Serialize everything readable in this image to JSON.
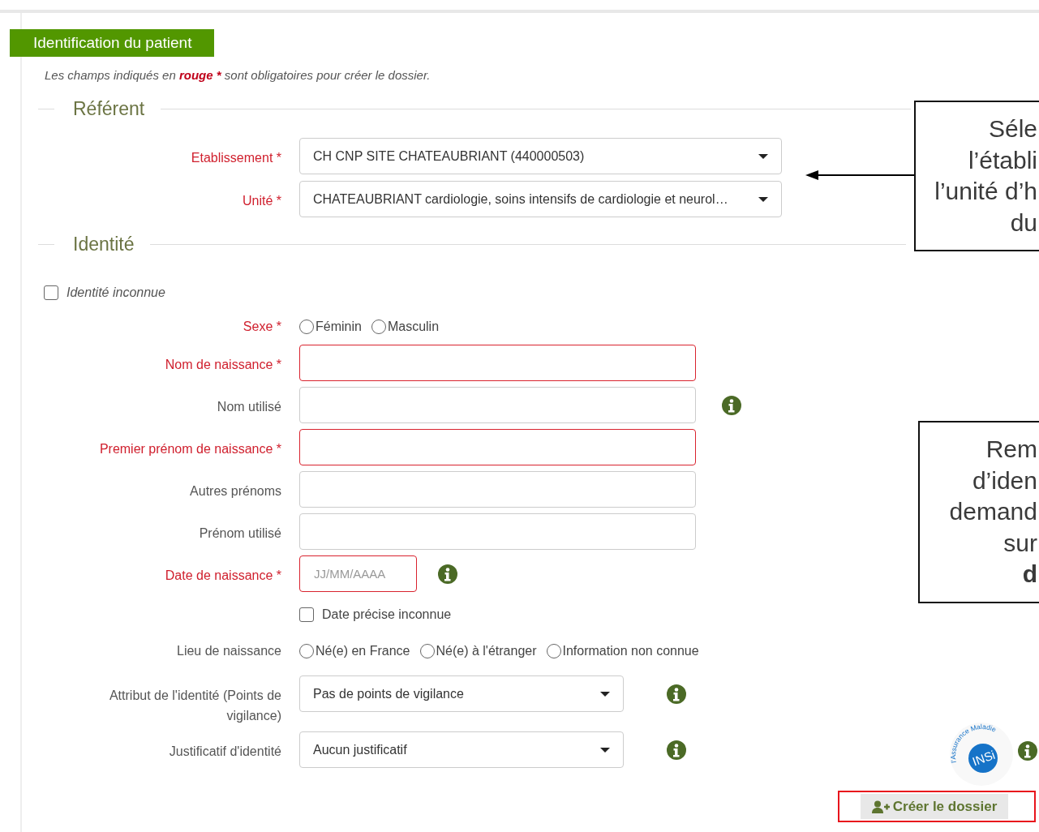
{
  "header": {
    "title": "Identification du patient"
  },
  "notice": {
    "before": "Les champs indiqués en",
    "emphasis": "rouge *",
    "after": "sont obligatoires pour créer le dossier."
  },
  "sections": [
    {
      "legend": "Référent",
      "fields": [
        {
          "kind": "select",
          "label": "Etablissement *",
          "required": true,
          "value": "CH CNP SITE CHATEAUBRIANT (440000503)",
          "info": false
        },
        {
          "kind": "select",
          "label": "Unité *",
          "required": true,
          "value": "CHATEAUBRIANT cardiologie, soins intensifs de cardiologie et neurol…",
          "info": false
        }
      ]
    },
    {
      "legend": "Identité",
      "fields": [
        {
          "kind": "flag",
          "label": "Identité inconnue",
          "checked": false
        },
        {
          "kind": "radio",
          "label": "Sexe *",
          "required": true,
          "options": [
            {
              "label": "Féminin",
              "selected": false
            },
            {
              "label": "Masculin",
              "selected": false
            }
          ]
        },
        {
          "kind": "text",
          "label": "Nom de naissance *",
          "required": true,
          "info": false
        },
        {
          "kind": "text",
          "label": "Nom utilisé",
          "required": false,
          "info": true
        },
        {
          "kind": "text",
          "label": "Premier prénom de naissance *",
          "required": true,
          "info": false
        },
        {
          "kind": "text",
          "label": "Autres prénoms",
          "required": false,
          "info": false
        },
        {
          "kind": "text",
          "label": "Prénom utilisé",
          "required": false,
          "info": false
        },
        {
          "kind": "date",
          "label": "Date de naissance *",
          "required": true,
          "placeholder": "JJ/MM/AAAA",
          "info": true
        },
        {
          "kind": "checkbox",
          "label": "Date précise inconnue",
          "checked": false
        },
        {
          "kind": "radio",
          "label": "Lieu de naissance",
          "required": false,
          "options": [
            {
              "label": "Né(e) en France",
              "selected": false
            },
            {
              "label": "Né(e) à l'étranger",
              "selected": false
            },
            {
              "label": "Information non connue",
              "selected": false
            }
          ]
        },
        {
          "kind": "select",
          "label": "Attribut de l'identité (Points de vigilance)",
          "required": false,
          "value": "Pas de points de vigilance",
          "info": true
        },
        {
          "kind": "select",
          "label": "Justificatif d'identité",
          "required": false,
          "value": "Aucun justificatif",
          "info": true
        }
      ]
    }
  ],
  "insi_logo": {
    "text": "INSi",
    "caption": "l'Assurance Maladie"
  },
  "create_button": {
    "label": "Créer le dossier"
  },
  "callouts": [
    {
      "lines": [
        {
          "text": "Séle",
          "bold": false
        },
        {
          "text": "l’établi",
          "bold": false
        },
        {
          "text": "l’unité d’h",
          "bold": false
        },
        {
          "text": "du",
          "bold": false
        }
      ]
    },
    {
      "lines": [
        {
          "text": "Rem",
          "bold": false
        },
        {
          "text": "d’iden",
          "bold": false
        },
        {
          "text": "demand",
          "bold": false
        },
        {
          "text": "sur",
          "bold": false
        },
        {
          "text": "d",
          "bold": true
        }
      ]
    }
  ]
}
